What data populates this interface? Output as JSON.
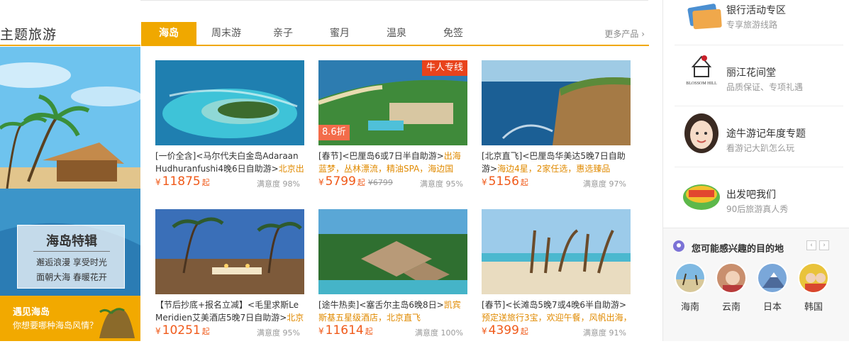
{
  "section": {
    "title": "主题旅游",
    "tabs": [
      "海岛",
      "周末游",
      "亲子",
      "蜜月",
      "温泉",
      "免签"
    ],
    "more": "更多产品 ›"
  },
  "banner": {
    "card_title": "海岛特辑",
    "card_line1": "邂逅浪漫 享受时光",
    "card_line2": "面朝大海 春暖花开",
    "foot_title": "遇见海岛",
    "foot_sub": "你想要哪种海岛风情？"
  },
  "products": [
    {
      "desc_prefix": "[一价全含]<马尔代夫白金岛Adaraan Hudhuranfushi4晚6日自助游>",
      "desc_hl": "北京出",
      "currency": "¥",
      "price": "11875",
      "qi": "起",
      "orig": "",
      "sat_label": "满意度",
      "sat_value": "98%",
      "badge_top": "",
      "badge_disc": ""
    },
    {
      "desc_prefix": "[春节]<巴厘岛6或7日半自助游>",
      "desc_hl": "出海蓝梦，丛林漂流，精油SPA，海边国五，",
      "currency": "¥",
      "price": "5799",
      "qi": "起",
      "orig": "¥6799",
      "sat_label": "满意度",
      "sat_value": "95%",
      "badge_top": "牛人专线",
      "badge_disc": "8.6折"
    },
    {
      "desc_prefix": "[北京直飞]<巴厘岛华美达5晚7日自助游>",
      "desc_hl": "海边4星，2家任选，惠选臻品",
      "currency": "¥",
      "price": "5156",
      "qi": "起",
      "orig": "",
      "sat_label": "满意度",
      "sat_value": "97%",
      "badge_top": "",
      "badge_disc": ""
    },
    {
      "desc_prefix": "【节后抄底+报名立减】<毛里求斯Le Meridien艾美酒店5晚7日自助游>",
      "desc_hl": "北京",
      "currency": "¥",
      "price": "10251",
      "qi": "起",
      "orig": "",
      "sat_label": "满意度",
      "sat_value": "95%",
      "badge_top": "",
      "badge_disc": ""
    },
    {
      "desc_prefix": "[途牛热卖]<塞舌尔主岛6晚8日>",
      "desc_hl": "凯宾斯基五星级酒店，北京直飞",
      "currency": "¥",
      "price": "11614",
      "qi": "起",
      "orig": "",
      "sat_label": "满意度",
      "sat_value": "100%",
      "badge_top": "",
      "badge_disc": ""
    },
    {
      "desc_prefix": "[春节]<长滩岛5晚7或4晚6半自助游>",
      "desc_hl": "预定送旅行3宝，欢迎午餐，风帆出海，",
      "currency": "¥",
      "price": "4399",
      "qi": "起",
      "orig": "",
      "sat_label": "满意度",
      "sat_value": "91%",
      "badge_top": "",
      "badge_disc": ""
    }
  ],
  "sidebar": {
    "promos": [
      {
        "title": "银行活动专区",
        "sub": "专享旅游线路",
        "icon": "bank-card-icon"
      },
      {
        "title": "丽江花间堂",
        "sub": "品质保证、专项礼遇",
        "icon": "blossom-hill-logo",
        "logo_text": "BLOSSOM HILL"
      },
      {
        "title": "途牛游记年度专题",
        "sub": "看游记大趴怎么玩",
        "icon": "travel-girl-avatar"
      },
      {
        "title": "出发吧我们",
        "sub": "90后旅游真人秀",
        "icon": "show-logo-icon"
      }
    ],
    "interest_title": "您可能感兴趣的目的地",
    "destinations": [
      "海南",
      "云南",
      "日本",
      "韩国"
    ]
  }
}
